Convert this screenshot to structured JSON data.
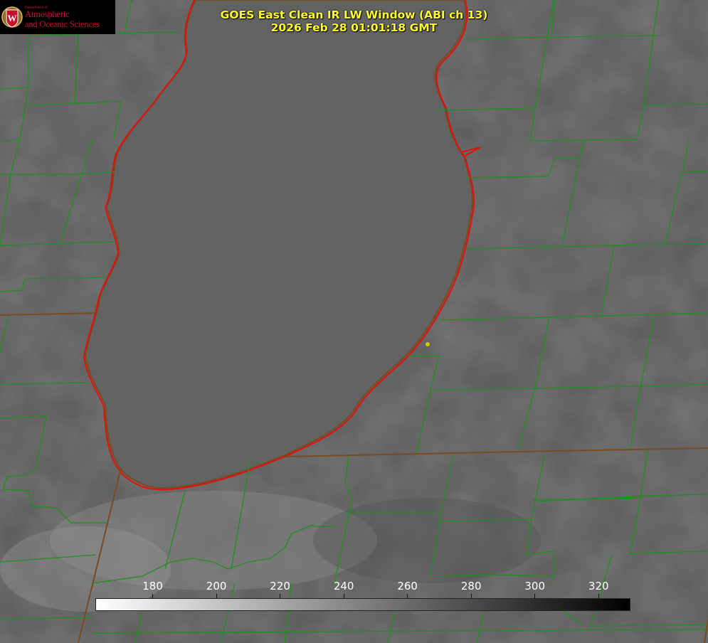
{
  "title": {
    "line1": "GOES East Clean IR LW Window (ABI ch 13)",
    "line2": "2026 Feb 28 01:01:18 GMT"
  },
  "logo": {
    "small_text": "Department of",
    "line1": "Atmospheric",
    "line2": "and Oceanic Sciences",
    "seal_letter": "W"
  },
  "colorbar": {
    "ticks": [
      "180",
      "200",
      "220",
      "240",
      "260",
      "280",
      "300",
      "320"
    ],
    "range_min": 162,
    "range_max": 330,
    "color_light_end": "#ffffff",
    "color_dark_end": "#000000"
  },
  "colors": {
    "title_text": "#ffff2a",
    "county_lines": "#1f8f1f",
    "state_lines": "#7a4a20",
    "lake_outline": "#e01010",
    "marker": "#d4c21a",
    "logo_red": "#c8102e"
  }
}
